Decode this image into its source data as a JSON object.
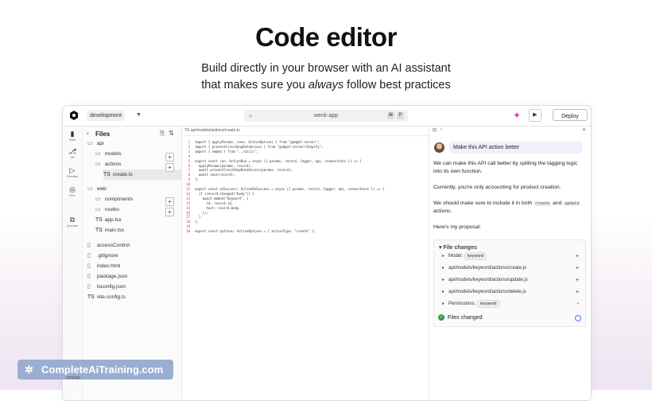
{
  "hero": {
    "title": "Code editor",
    "line1": "Build directly in your browser with an AI assistant",
    "line2_before": "that makes sure you ",
    "line2_em": "always",
    "line2_after": " follow best practices"
  },
  "topbar": {
    "branch": "development",
    "search": "wenk-app",
    "kbd1": "⌘",
    "kbd2": "P",
    "deploy": "Deploy"
  },
  "rail": [
    {
      "label": "Files",
      "icon": "file-icon"
    },
    {
      "label": "Git",
      "icon": "git-icon"
    },
    {
      "label": "Preview",
      "icon": "play-icon"
    },
    {
      "label": "Env",
      "icon": "env-icon"
    },
    {
      "label": "Queues",
      "icon": "queue-icon"
    }
  ],
  "explorer": {
    "title": "Files",
    "items": [
      {
        "label": "api",
        "kind": "folder",
        "depth": 0
      },
      {
        "label": "models",
        "kind": "folder",
        "depth": 1
      },
      {
        "label": "actions",
        "kind": "folder",
        "depth": 1
      },
      {
        "label": "create.ts",
        "kind": "ts",
        "depth": 2
      },
      {
        "label": "web",
        "kind": "folder",
        "depth": 0
      },
      {
        "label": "components",
        "kind": "folder",
        "depth": 1
      },
      {
        "label": "routes",
        "kind": "folder",
        "depth": 1
      },
      {
        "label": "app.tsx",
        "kind": "ts",
        "depth": 1
      },
      {
        "label": "main.tsx",
        "kind": "ts",
        "depth": 1
      },
      {
        "label": "accessControl",
        "kind": "file",
        "depth": 0
      },
      {
        "label": ".gitignore",
        "kind": "file",
        "depth": 0
      },
      {
        "label": "index.html",
        "kind": "file",
        "depth": 0
      },
      {
        "label": "package.json",
        "kind": "file",
        "depth": 0
      },
      {
        "label": "tsconfig.json",
        "kind": "file",
        "depth": 0
      },
      {
        "label": "vite.config.ts",
        "kind": "ts",
        "depth": 0
      }
    ],
    "settings_label": "Settings"
  },
  "editor": {
    "tab": "TS api/models/actions/create.ts",
    "lines": [
      "import { applyParams, save, ActionOptions } from \"gadget-server\";",
      "import { preventCrossShopDataAccess } from \"gadget-server/shopify\";",
      "import { embed } from \"../utils\";",
      "",
      "export const run: ActionRun = async ({ params, record, logger, api, connections }) => {",
      "  applyParams(params, record);",
      "  await preventCrossShopDataAccess(params, record);",
      "  await save(record);",
      "};",
      "",
      "export const onSuccess: ActionOnSuccess = async ({ params, record, logger, api, connections }) => {",
      "  if (record.changed(\"body\")) {",
      "    await embed(\"keyword\", {",
      "      id: record.id,",
      "      text: record.body",
      "    });",
      "  }",
      "};",
      "",
      "export const options: ActionOptions = { actionType: \"create\" };"
    ]
  },
  "chat": {
    "user_message": "Make this API action better",
    "p1": "We can make this API call better by spliting the tagging logic into its own function.",
    "p2": "Currently, you're only accounting for product creation.",
    "p3_before": "We should make sure to include it in both ",
    "p3_code1": "create",
    "p3_mid": " and ",
    "p3_code2": "update",
    "p3_after": " actions.",
    "p4": "Here's my proposal:",
    "changes_title": "File changes",
    "changes": [
      {
        "prefix": "Model:",
        "pill": "keyword",
        "mark": "+",
        "mark_color": "#2e9e4e"
      },
      {
        "prefix": "api/models/keyword/actions/create.js",
        "pill": "",
        "mark": "+",
        "mark_color": "#2e9e4e"
      },
      {
        "prefix": "api/models/keyword/actions/update.js",
        "pill": "",
        "mark": "+",
        "mark_color": "#2e9e4e"
      },
      {
        "prefix": "api/models/keyword/actions/delete.js",
        "pill": "",
        "mark": "+",
        "mark_color": "#2e9e4e"
      },
      {
        "prefix": "Permissions:",
        "pill": "keyword",
        "mark": "•",
        "mark_color": "#e0922e"
      }
    ],
    "status": "Files changed"
  },
  "watermark": "CompleteAiTraining.com",
  "colors": {
    "accent": "#d63fb3",
    "line_numbers": "#c0392b",
    "ts": "#2f6dc7"
  }
}
